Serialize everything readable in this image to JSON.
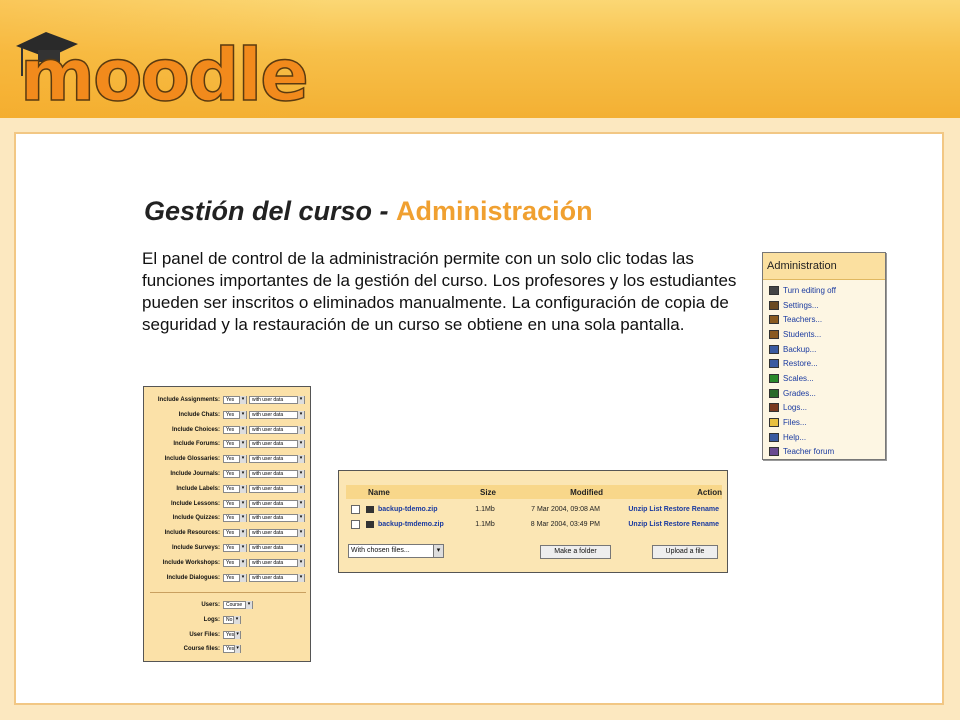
{
  "header": {
    "logo_text": "moodle"
  },
  "slide": {
    "title_main": "Gestión del curso - ",
    "title_accent": "Administración",
    "description": "El panel de control de la administración permite con un solo clic todas las funciones importantes de la gestión del curso.  Los profesores y los estudiantes pueden ser inscritos o eliminados manualmente.  La configuración de copia de seguridad y la restauración de un curso se obtiene en una sola pantalla."
  },
  "admin_block": {
    "title": "Administration",
    "items": [
      {
        "label": "Turn editing off",
        "icon": "pencil-icon"
      },
      {
        "label": "Settings...",
        "icon": "settings-icon"
      },
      {
        "label": "Teachers...",
        "icon": "teachers-icon"
      },
      {
        "label": "Students...",
        "icon": "students-icon"
      },
      {
        "label": "Backup...",
        "icon": "backup-icon"
      },
      {
        "label": "Restore...",
        "icon": "restore-icon"
      },
      {
        "label": "Scales...",
        "icon": "scales-icon"
      },
      {
        "label": "Grades...",
        "icon": "grades-icon"
      },
      {
        "label": "Logs...",
        "icon": "logs-icon"
      },
      {
        "label": "Files...",
        "icon": "folder-icon"
      },
      {
        "label": "Help...",
        "icon": "help-icon"
      },
      {
        "label": "Teacher forum",
        "icon": "forum-icon"
      }
    ]
  },
  "backup_settings": {
    "modules": [
      {
        "label": "Include Assignments:",
        "value": "Yes",
        "userdata": "with user data"
      },
      {
        "label": "Include Chats:",
        "value": "Yes",
        "userdata": "with user data"
      },
      {
        "label": "Include Choices:",
        "value": "Yes",
        "userdata": "with user data"
      },
      {
        "label": "Include Forums:",
        "value": "Yes",
        "userdata": "with user data"
      },
      {
        "label": "Include Glossaries:",
        "value": "Yes",
        "userdata": "with user data"
      },
      {
        "label": "Include Journals:",
        "value": "Yes",
        "userdata": "with user data"
      },
      {
        "label": "Include Labels:",
        "value": "Yes",
        "userdata": "with user data"
      },
      {
        "label": "Include Lessons:",
        "value": "Yes",
        "userdata": "with user data"
      },
      {
        "label": "Include Quizzes:",
        "value": "Yes",
        "userdata": "with user data"
      },
      {
        "label": "Include Resources:",
        "value": "Yes",
        "userdata": "with user data"
      },
      {
        "label": "Include Surveys:",
        "value": "Yes",
        "userdata": "with user data"
      },
      {
        "label": "Include Workshops:",
        "value": "Yes",
        "userdata": "with user data"
      },
      {
        "label": "Include Dialogues:",
        "value": "Yes",
        "userdata": "with user data"
      }
    ],
    "options": [
      {
        "label": "Users:",
        "value": "Course"
      },
      {
        "label": "Logs:",
        "value": "No"
      },
      {
        "label": "User Files:",
        "value": "Yes"
      },
      {
        "label": "Course files:",
        "value": "Yes"
      }
    ]
  },
  "files_panel": {
    "columns": {
      "name": "Name",
      "size": "Size",
      "modified": "Modified",
      "action": "Action"
    },
    "rows": [
      {
        "name": "backup-tdemo.zip",
        "size": "1.1Mb",
        "modified": "7 Mar 2004, 09:08 AM",
        "actions": "Unzip List Restore Rename"
      },
      {
        "name": "backup-tmdemo.zip",
        "size": "1.1Mb",
        "modified": "8 Mar 2004, 03:49 PM",
        "actions": "Unzip List Restore Rename"
      }
    ],
    "chosen_select": "With chosen files...",
    "make_folder": "Make a folder",
    "upload": "Upload a file"
  }
}
